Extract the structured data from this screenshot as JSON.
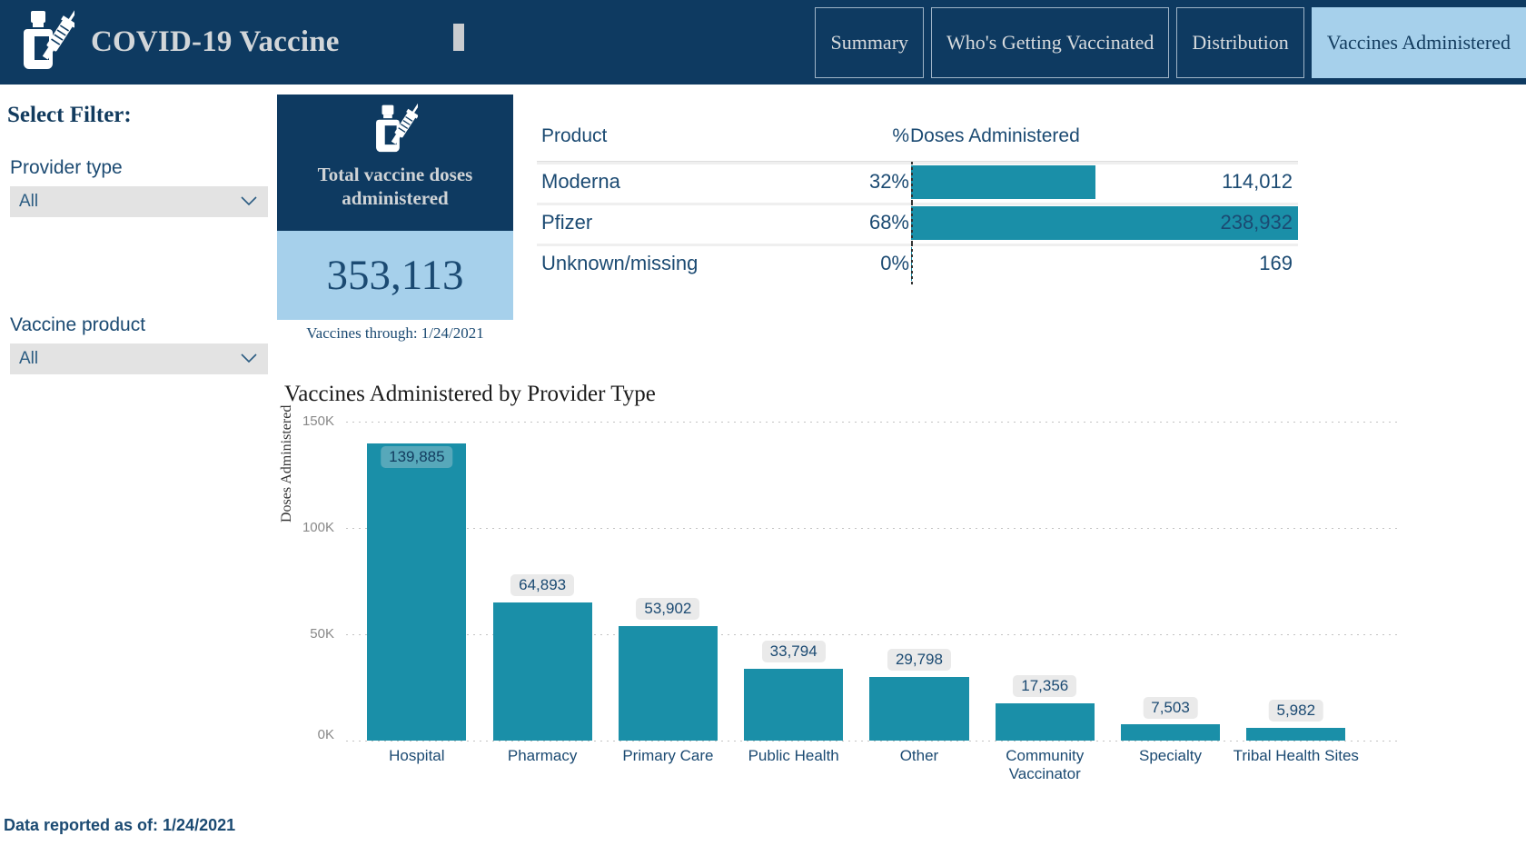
{
  "header": {
    "app_title": "COVID-19 Vaccine",
    "logo_icon": "vaccine-vial-syringe-icon",
    "tick_marker": "|",
    "tabs": [
      {
        "label": "Summary",
        "active": false
      },
      {
        "label": "Who's Getting Vaccinated",
        "active": false
      },
      {
        "label": "Distribution",
        "active": false
      },
      {
        "label": "Vaccines Administered",
        "active": true
      }
    ]
  },
  "sidebar": {
    "title": "Select Filter:",
    "filters": [
      {
        "label": "Provider type",
        "value": "All",
        "icon": "chevron-down-icon"
      },
      {
        "label": "Vaccine product",
        "value": "All",
        "icon": "chevron-down-icon"
      }
    ]
  },
  "kpi": {
    "icon": "vaccine-vial-syringe-icon",
    "title": "Total vaccine doses administered",
    "value": "353,113",
    "caption": "Vaccines through: 1/24/2021"
  },
  "product_table": {
    "columns": [
      "Product",
      "%",
      "Doses Administered"
    ],
    "rows": [
      {
        "product": "Moderna",
        "percent": "32%",
        "doses": "114,012",
        "bar_fraction": 0.477,
        "label_inside": false
      },
      {
        "product": "Pfizer",
        "percent": "68%",
        "doses": "238,932",
        "bar_fraction": 1.0,
        "label_inside": true
      },
      {
        "product": "Unknown/missing",
        "percent": "0%",
        "doses": "169",
        "bar_fraction": 0.0007,
        "label_inside": false
      }
    ]
  },
  "footer": {
    "text": "Data reported as of: 1/24/2021"
  },
  "chart_data": {
    "type": "bar",
    "title": "Vaccines Administered by Provider Type",
    "xlabel": "",
    "ylabel": "Doses Administered",
    "ylim": [
      0,
      150000
    ],
    "yticks": [
      0,
      50000,
      100000,
      150000
    ],
    "ytick_labels": [
      "0K",
      "50K",
      "100K",
      "150K"
    ],
    "grid": true,
    "legend": "none",
    "bar_color": "#1a8fa8",
    "categories": [
      "Hospital",
      "Pharmacy",
      "Primary Care",
      "Public Health",
      "Other",
      "Community\nVaccinator",
      "Specialty",
      "Tribal Health Sites"
    ],
    "values": [
      139885,
      64893,
      53902,
      33794,
      29798,
      17356,
      7503,
      5982
    ],
    "value_labels": [
      "139,885",
      "64,893",
      "53,902",
      "33,794",
      "29,798",
      "17,356",
      "7,503",
      "5,982"
    ]
  }
}
